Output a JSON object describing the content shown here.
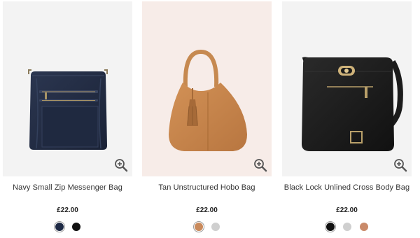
{
  "products": [
    {
      "name": "Navy Small Zip Messenger Bag",
      "price": "£22.00",
      "image_icon": "navy-messenger-bag-image",
      "swatches": [
        {
          "color": "#1e2a45",
          "name": "navy",
          "selected": true
        },
        {
          "color": "#111111",
          "name": "black",
          "selected": false
        }
      ]
    },
    {
      "name": "Tan Unstructured Hobo Bag",
      "price": "£22.00",
      "image_icon": "tan-hobo-bag-image",
      "swatches": [
        {
          "color": "#c98a5c",
          "name": "tan",
          "selected": true
        },
        {
          "color": "#cfcfcf",
          "name": "grey",
          "selected": false
        }
      ]
    },
    {
      "name": "Black Lock Unlined Cross Body Bag",
      "price": "£22.00",
      "image_icon": "black-crossbody-bag-image",
      "swatches": [
        {
          "color": "#111111",
          "name": "black",
          "selected": true
        },
        {
          "color": "#cfcfcf",
          "name": "grey",
          "selected": false
        },
        {
          "color": "#c98a6a",
          "name": "tan",
          "selected": false
        }
      ]
    }
  ],
  "zoom_icon": "zoom-in-icon",
  "colors": {
    "text": "#333333",
    "card_bg_neutral": "#f3f3f3",
    "card_bg_pink": "#f7ece8"
  }
}
